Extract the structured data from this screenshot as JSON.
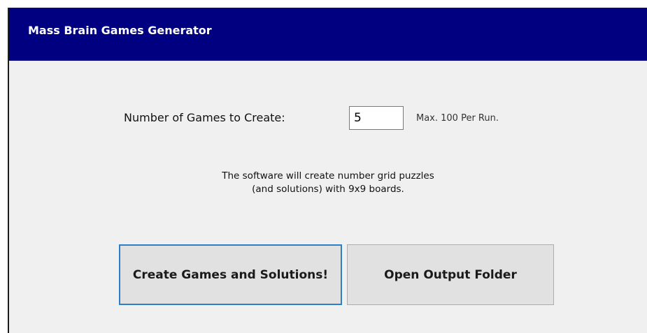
{
  "window": {
    "title": "Mass Brain Games Generator"
  },
  "form": {
    "count_label": "Number of Games to Create:",
    "count_value": "5",
    "max_note": "Max. 100 Per Run."
  },
  "description": {
    "line1": "The software will create number grid puzzles",
    "line2": "(and solutions) with 9x9 boards."
  },
  "buttons": {
    "create_label": "Create Games and Solutions!",
    "open_label": "Open Output Folder"
  },
  "colors": {
    "titlebar": "#000080",
    "window_bg": "#f0f0f0",
    "button_bg": "#e1e1e1",
    "focus_border": "#2f7fc8"
  }
}
